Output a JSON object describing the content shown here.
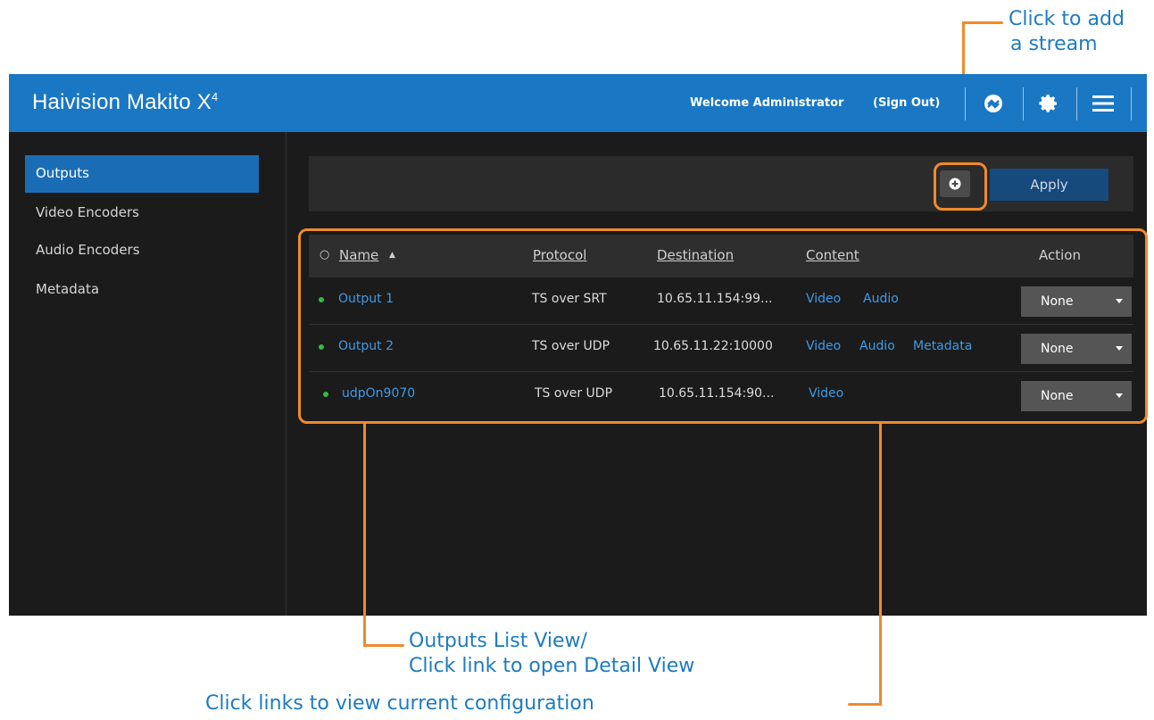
{
  "header": {
    "brand": "Haivision Makito X",
    "brand_sup": "4",
    "welcome": "Welcome Administrator",
    "signout": "(Sign Out)",
    "icons": [
      "network-status-icon",
      "gear-icon",
      "menu-icon"
    ]
  },
  "sidebar": {
    "items": [
      {
        "label": "Outputs",
        "active": true
      },
      {
        "label": "Video Encoders"
      },
      {
        "label": "Audio Encoders"
      },
      {
        "label": "Metadata"
      }
    ]
  },
  "toolbar": {
    "add_icon": "plus-circle-icon",
    "apply_label": "Apply"
  },
  "table": {
    "columns": [
      "Name",
      "Protocol",
      "Destination",
      "Content",
      "Action"
    ],
    "sort_indicator": "▲",
    "select_all": "○",
    "rows": [
      {
        "name": "Output 1",
        "protocol": "TS over SRT",
        "destination": "10.65.11.154:99...",
        "content": [
          "Video",
          "Audio"
        ],
        "action": "None"
      },
      {
        "name": "Output 2",
        "protocol": "TS over UDP",
        "destination": "10.65.11.22:10000",
        "content": [
          "Video",
          "Audio",
          "Metadata"
        ],
        "action": "None"
      },
      {
        "name": "udpOn9070",
        "protocol": "TS over UDP",
        "destination": "10.65.11.154:90...",
        "content": [
          "Video"
        ],
        "action": "None"
      }
    ]
  },
  "callouts": {
    "add_stream_1": "Click to add",
    "add_stream_2": "a stream",
    "list_view_1": "Outputs List View/",
    "list_view_2": "Click link to open Detail View",
    "config": "Click links to view current configuration"
  },
  "colors": {
    "accent": "#1a77c4",
    "callout_orange": "#f08a2c",
    "callout_text": "#1d7bbf",
    "link": "#3d9be8",
    "status_green": "#2fbf3a"
  }
}
